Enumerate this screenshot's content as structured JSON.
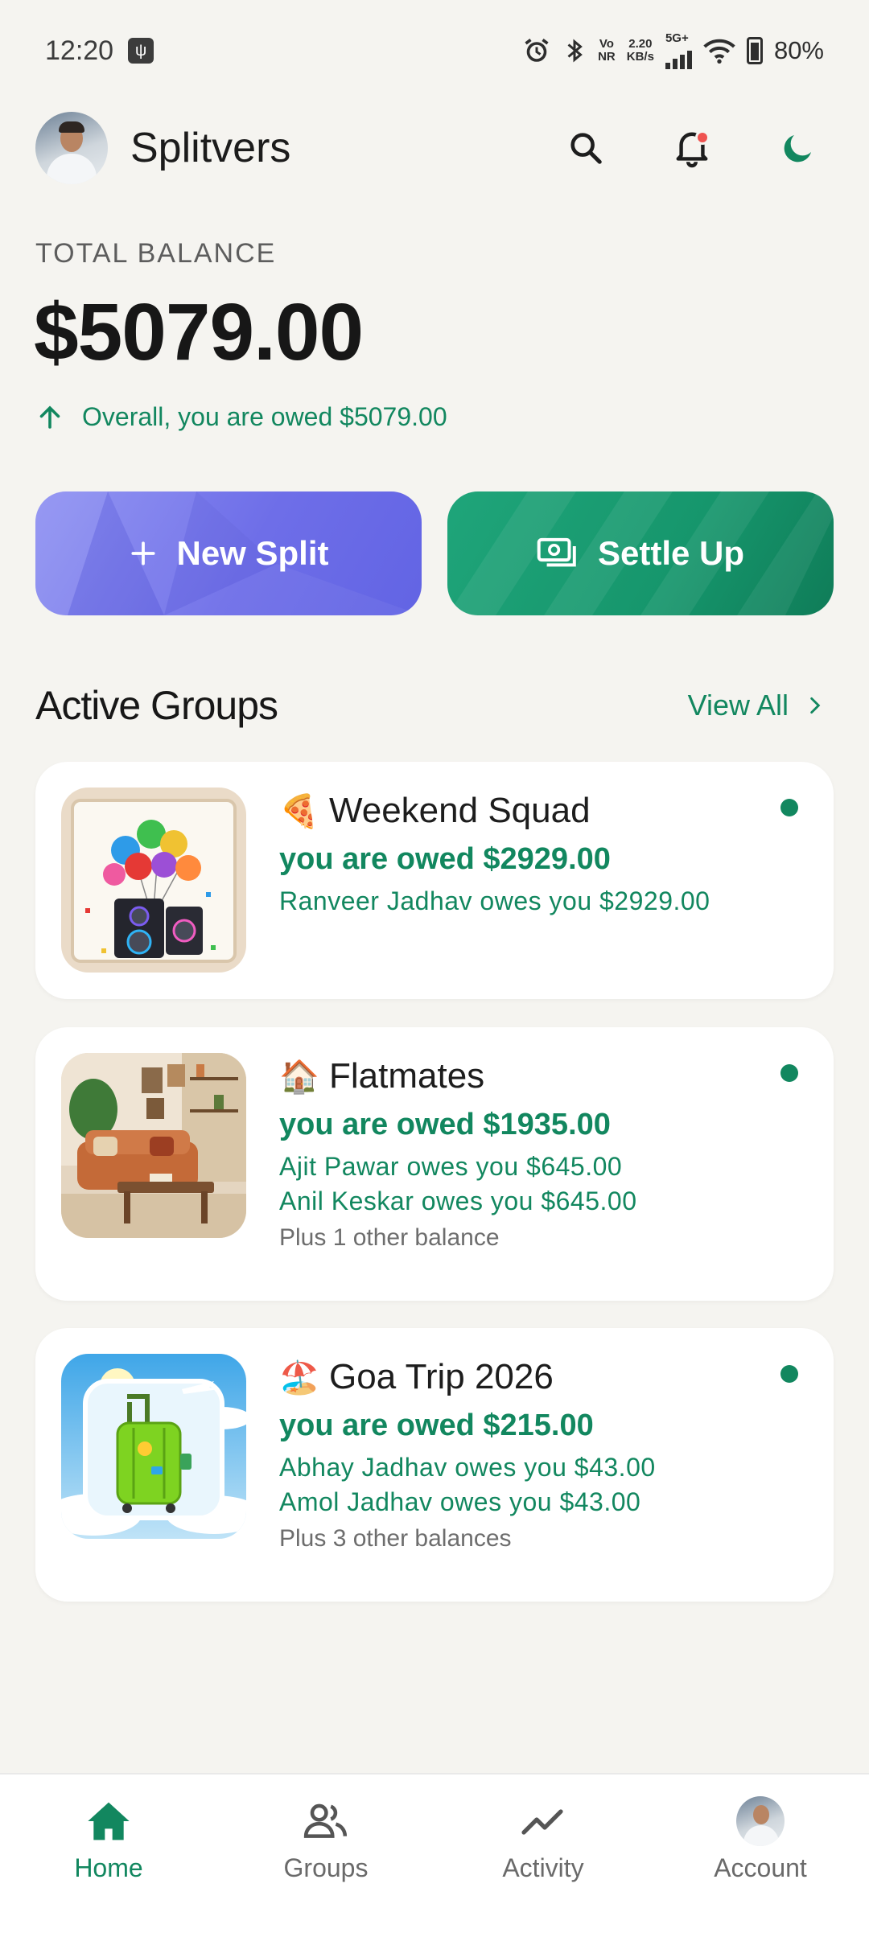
{
  "status_bar": {
    "time": "12:20",
    "network_speed_value": "2.20",
    "network_speed_unit": "KB/s",
    "vo_top": "Vo",
    "vo_bottom": "NR",
    "signal_label": "5G+",
    "battery": "80%"
  },
  "header": {
    "app_name": "Splitvers"
  },
  "balance": {
    "label": "TOTAL BALANCE",
    "amount": "$5079.00",
    "note": "Overall, you are owed $5079.00"
  },
  "actions": {
    "new_split": "New Split",
    "settle_up": "Settle Up"
  },
  "groups_section": {
    "title": "Active Groups",
    "view_all": "View All"
  },
  "groups": [
    {
      "emoji": "🍕",
      "name": "Weekend Squad",
      "summary": "you are owed $2929.00",
      "lines": [
        "Ranveer Jadhav owes you $2929.00"
      ],
      "more": ""
    },
    {
      "emoji": "🏠",
      "name": "Flatmates",
      "summary": "you are owed $1935.00",
      "lines": [
        "Ajit Pawar owes you $645.00",
        "Anil Keskar owes you $645.00"
      ],
      "more": "Plus 1 other balance"
    },
    {
      "emoji": "🏖️",
      "name": "Goa Trip 2026",
      "summary": "you are owed $215.00",
      "lines": [
        "Abhay Jadhav owes you $43.00",
        "Amol Jadhav owes you $43.00"
      ],
      "more": "Plus 3 other balances"
    }
  ],
  "bottom_nav": {
    "home": "Home",
    "groups": "Groups",
    "activity": "Activity",
    "account": "Account"
  },
  "colors": {
    "accent_green": "#12875f",
    "purple_button": "#6e6ee8",
    "background": "#f5f4f0"
  }
}
